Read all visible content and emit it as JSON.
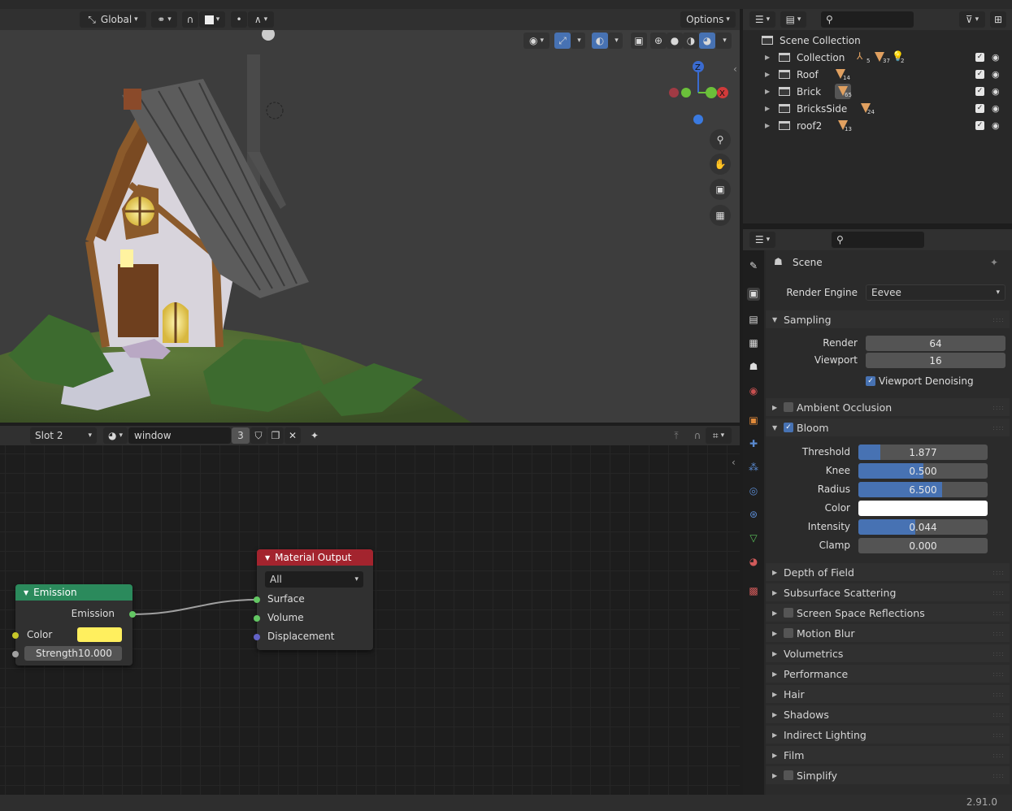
{
  "colors": {
    "accent": "#4772b3",
    "emission_header": "#2b8a5c",
    "output_header": "#a3242e",
    "emission_color": "#ffef5e",
    "socket_yellow": "#c7c729",
    "socket_green": "#63c763",
    "socket_purple": "#6363c7",
    "socket_gray": "#a1a1a1"
  },
  "viewport_header": {
    "orientation": "Global",
    "options": "Options"
  },
  "outliner": {
    "scene_collection": "Scene Collection",
    "items": [
      {
        "label": "Collection",
        "counts": [
          "5",
          "37",
          "2"
        ]
      },
      {
        "label": "Roof",
        "counts": [
          "14"
        ]
      },
      {
        "label": "Brick",
        "counts": [
          "65"
        ]
      },
      {
        "label": "BricksSide",
        "counts": [
          "24"
        ]
      },
      {
        "label": "roof2",
        "counts": [
          "13"
        ]
      }
    ]
  },
  "properties": {
    "context": "Scene",
    "render_engine": {
      "label": "Render Engine",
      "value": "Eevee"
    },
    "sampling": {
      "title": "Sampling",
      "render_label": "Render",
      "render_value": "64",
      "viewport_label": "Viewport",
      "viewport_value": "16",
      "denoise": "Viewport Denoising"
    },
    "ambient_occlusion": "Ambient Occlusion",
    "bloom": {
      "title": "Bloom",
      "threshold_label": "Threshold",
      "threshold_value": "1.877",
      "threshold_fraction": 0.17,
      "knee_label": "Knee",
      "knee_value": "0.500",
      "knee_fraction": 0.5,
      "radius_label": "Radius",
      "radius_value": "6.500",
      "radius_fraction": 0.65,
      "color_label": "Color",
      "color_value": "#ffffff",
      "intensity_label": "Intensity",
      "intensity_value": "0.044",
      "intensity_fraction": 0.44,
      "clamp_label": "Clamp",
      "clamp_value": "0.000",
      "clamp_fraction": 0
    },
    "panels": [
      {
        "label": "Depth of Field",
        "checkbox": false
      },
      {
        "label": "Subsurface Scattering",
        "checkbox": false
      },
      {
        "label": "Screen Space Reflections",
        "checkbox": true
      },
      {
        "label": "Motion Blur",
        "checkbox": true
      },
      {
        "label": "Volumetrics",
        "checkbox": false
      },
      {
        "label": "Performance",
        "checkbox": false
      },
      {
        "label": "Hair",
        "checkbox": false
      },
      {
        "label": "Shadows",
        "checkbox": false
      },
      {
        "label": "Indirect Lighting",
        "checkbox": false
      },
      {
        "label": "Film",
        "checkbox": false
      },
      {
        "label": "Simplify",
        "checkbox": true
      }
    ]
  },
  "node_header": {
    "slot": "Slot 2",
    "material": "window",
    "users": "3"
  },
  "nodes": {
    "emission": {
      "title": "Emission",
      "output": "Emission",
      "color_label": "Color",
      "strength_label": "Strength",
      "strength_value": "10.000"
    },
    "material_output": {
      "title": "Material Output",
      "target": "All",
      "surface": "Surface",
      "volume": "Volume",
      "displacement": "Displacement"
    }
  },
  "status": {
    "version": "2.91.0"
  }
}
